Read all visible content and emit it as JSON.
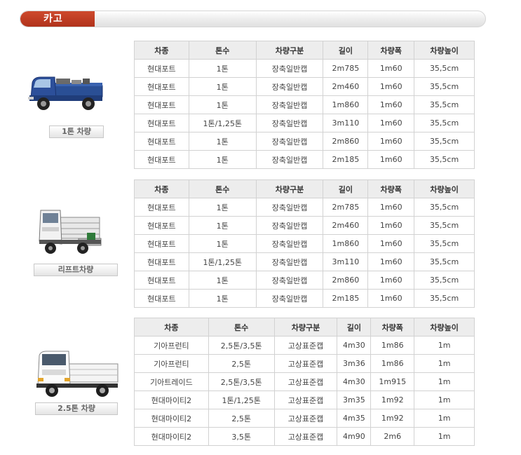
{
  "header": {
    "title": "카고"
  },
  "sections": [
    {
      "caption": "1톤 차량",
      "columns": [
        "차종",
        "톤수",
        "차량구분",
        "길이",
        "차량폭",
        "차량높이"
      ],
      "rows": [
        [
          "현대포트",
          "1톤",
          "장축일반캡",
          "2m785",
          "1m60",
          "35,5cm"
        ],
        [
          "현대포트",
          "1톤",
          "장축일반캡",
          "2m460",
          "1m60",
          "35,5cm"
        ],
        [
          "현대포트",
          "1톤",
          "장축일반캡",
          "1m860",
          "1m60",
          "35,5cm"
        ],
        [
          "현대포트",
          "1톤/1,25톤",
          "장축일반캡",
          "3m110",
          "1m60",
          "35,5cm"
        ],
        [
          "현대포트",
          "1톤",
          "장축일반캡",
          "2m860",
          "1m60",
          "35,5cm"
        ],
        [
          "현대포트",
          "1톤",
          "장축일반캡",
          "2m185",
          "1m60",
          "35,5cm"
        ]
      ]
    },
    {
      "caption": "리프트차량",
      "columns": [
        "차종",
        "톤수",
        "차량구분",
        "길이",
        "차량폭",
        "차량높이"
      ],
      "rows": [
        [
          "현대포트",
          "1톤",
          "장축일반캡",
          "2m785",
          "1m60",
          "35,5cm"
        ],
        [
          "현대포트",
          "1톤",
          "장축일반캡",
          "2m460",
          "1m60",
          "35,5cm"
        ],
        [
          "현대포트",
          "1톤",
          "장축일반캡",
          "1m860",
          "1m60",
          "35,5cm"
        ],
        [
          "현대포트",
          "1톤/1,25톤",
          "장축일반캡",
          "3m110",
          "1m60",
          "35,5cm"
        ],
        [
          "현대포트",
          "1톤",
          "장축일반캡",
          "2m860",
          "1m60",
          "35,5cm"
        ],
        [
          "현대포트",
          "1톤",
          "장축일반캡",
          "2m185",
          "1m60",
          "35,5cm"
        ]
      ]
    },
    {
      "caption": "2.5톤 차량",
      "columns": [
        "차종",
        "톤수",
        "차량구분",
        "길이",
        "차량폭",
        "차량높이"
      ],
      "rows": [
        [
          "기아프런티",
          "2,5톤/3,5톤",
          "고상표준캡",
          "4m30",
          "1m86",
          "1m"
        ],
        [
          "기아프런티",
          "2,5톤",
          "고상표준캡",
          "3m36",
          "1m86",
          "1m"
        ],
        [
          "기아트레이드",
          "2,5톤/3,5톤",
          "고상표준캡",
          "4m30",
          "1m915",
          "1m"
        ],
        [
          "현대마이티2",
          "1톤/1,25톤",
          "고상표준캡",
          "3m35",
          "1m92",
          "1m"
        ],
        [
          "현대마이티2",
          "2,5톤",
          "고상표준캡",
          "4m35",
          "1m92",
          "1m"
        ],
        [
          "현대마이티2",
          "3,5톤",
          "고상표준캡",
          "4m90",
          "2m6",
          "1m"
        ]
      ]
    }
  ]
}
